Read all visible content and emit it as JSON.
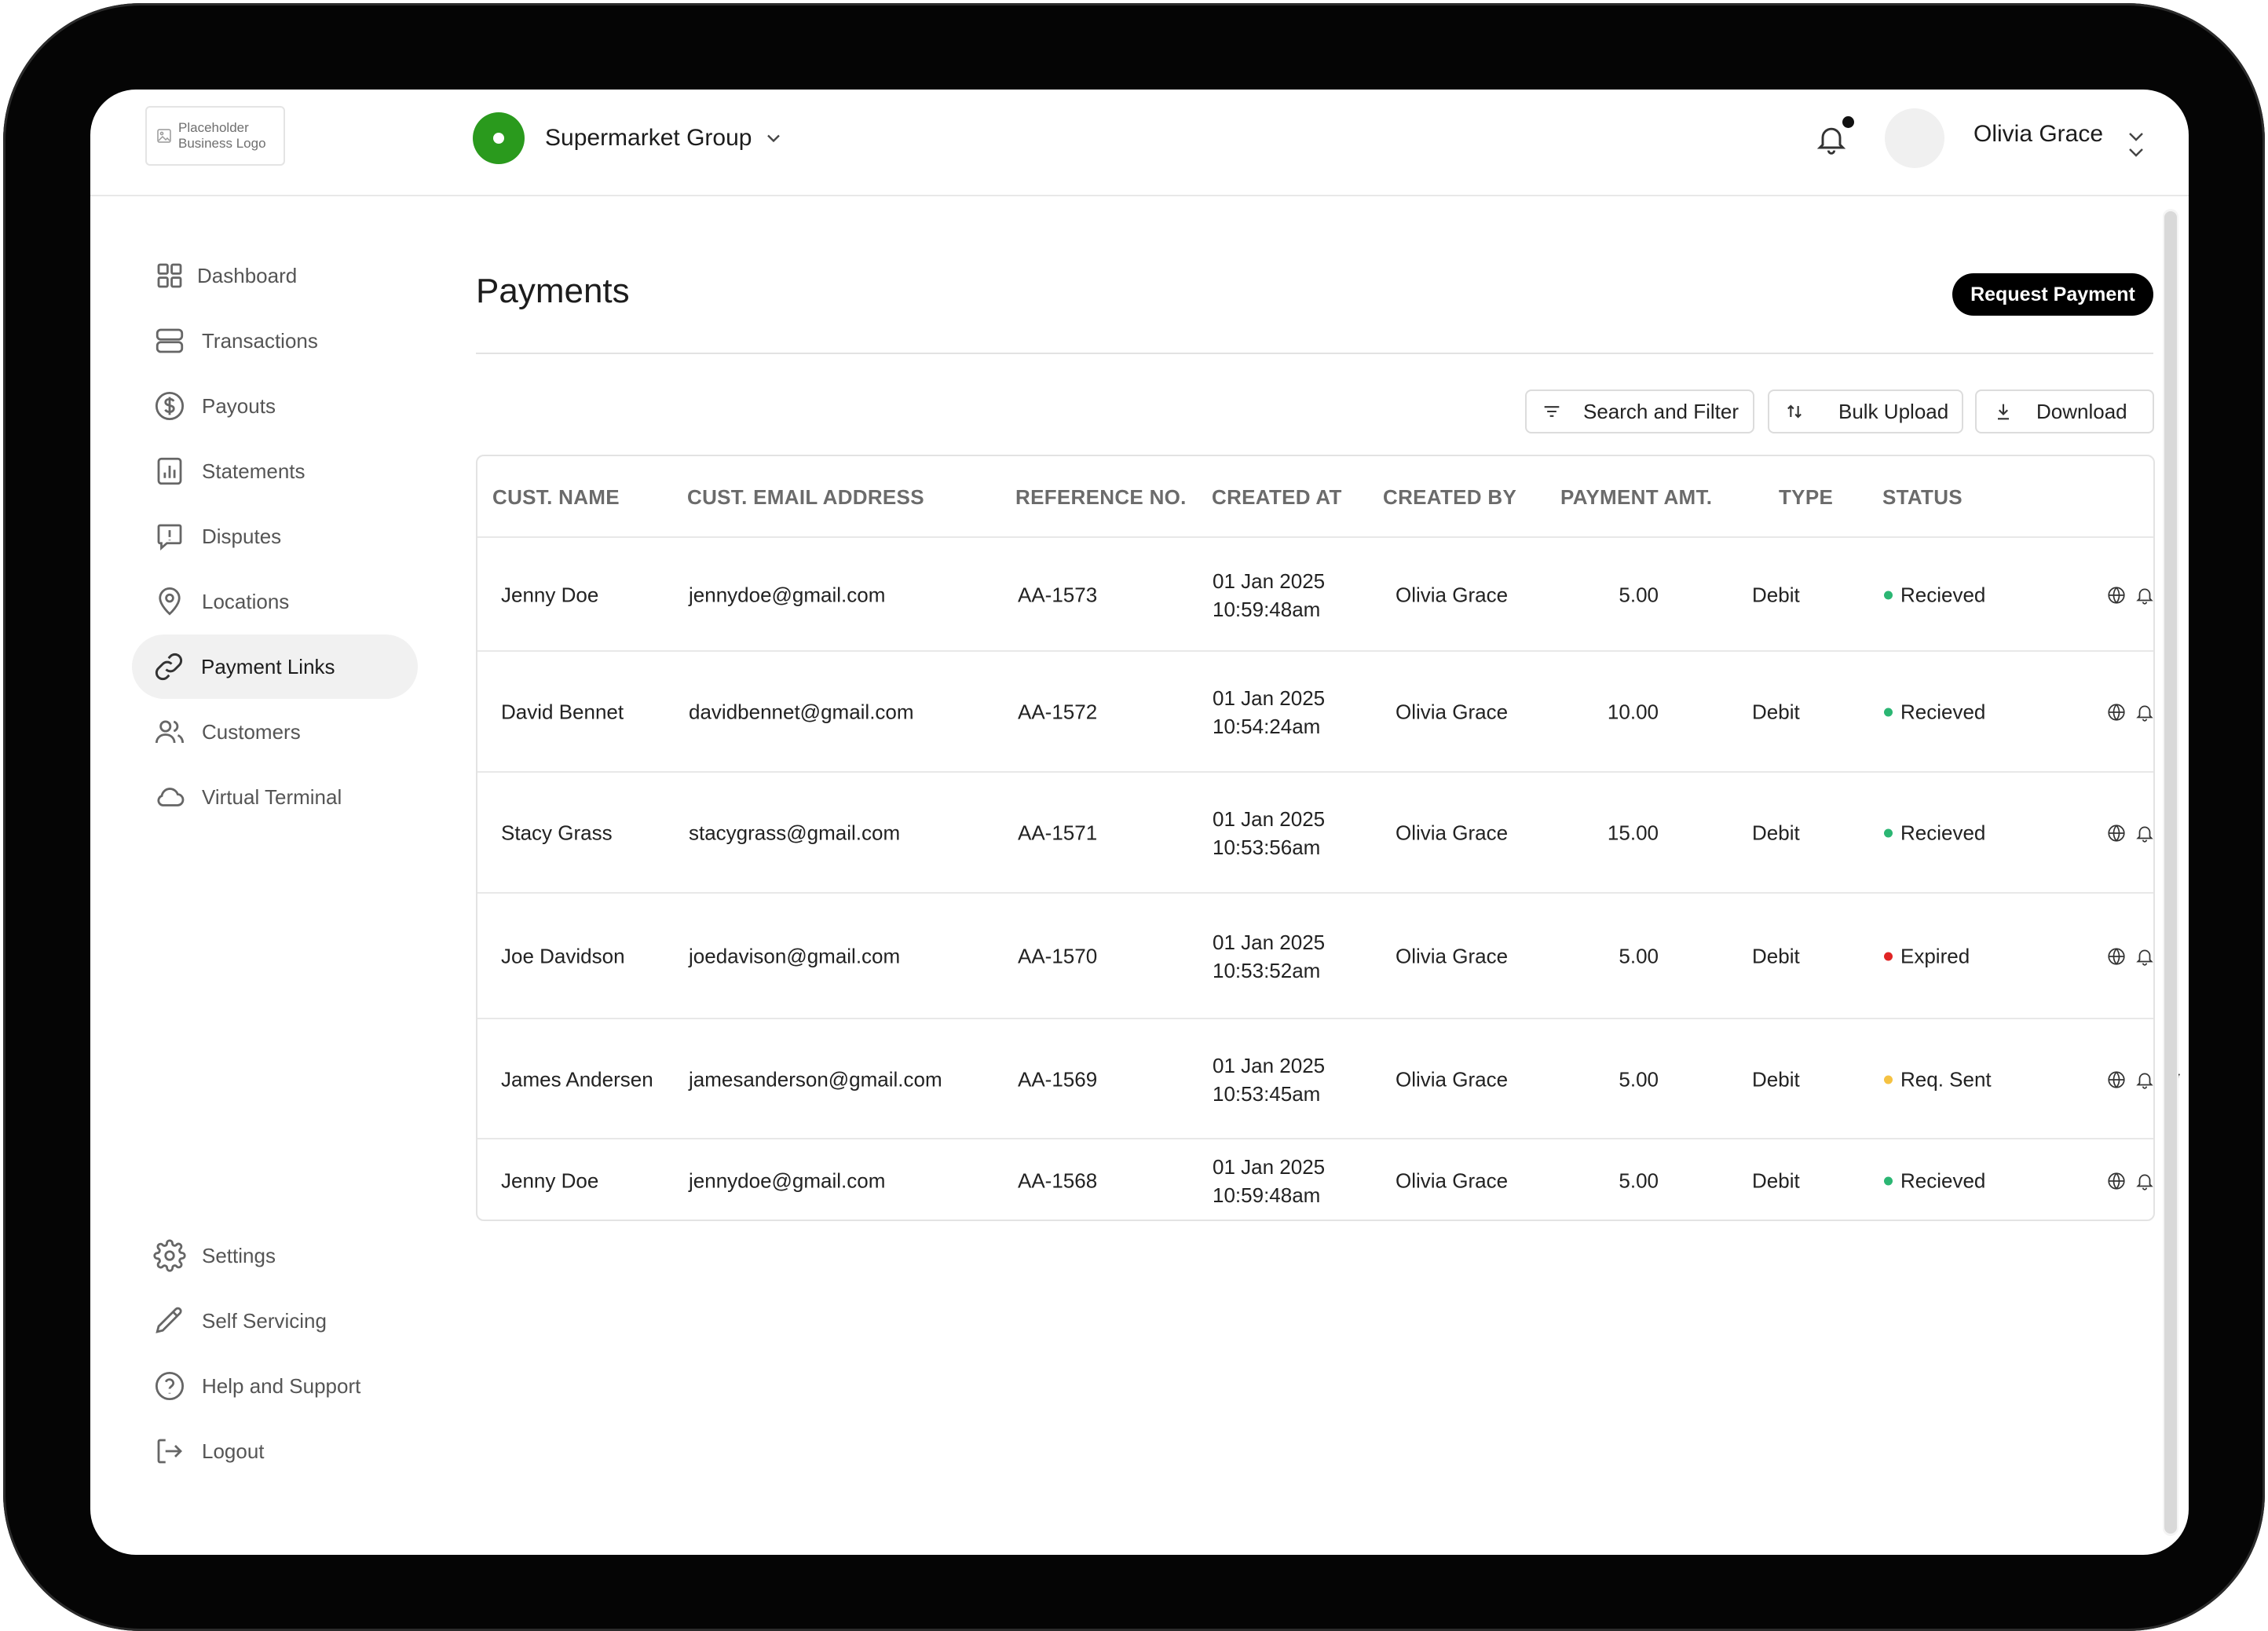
{
  "logo": {
    "line1": "Placeholder",
    "line2": "Business Logo"
  },
  "business": {
    "name": "Supermarket Group",
    "accent_color": "#2a9a1d"
  },
  "user": {
    "name": "Olivia Grace"
  },
  "sidebar": {
    "items": [
      {
        "label": "Dashboard",
        "icon": "grid-icon"
      },
      {
        "label": "Transactions",
        "icon": "layers-icon"
      },
      {
        "label": "Payouts",
        "icon": "dollar-circle-icon"
      },
      {
        "label": "Statements",
        "icon": "bar-chart-icon"
      },
      {
        "label": "Disputes",
        "icon": "alert-message-icon"
      },
      {
        "label": "Locations",
        "icon": "map-pin-icon"
      },
      {
        "label": "Payment Links",
        "icon": "link-icon",
        "active": true
      },
      {
        "label": "Customers",
        "icon": "users-icon"
      },
      {
        "label": "Virtual Terminal",
        "icon": "cloud-icon"
      }
    ],
    "bottom_items": [
      {
        "label": "Settings",
        "icon": "gear-icon"
      },
      {
        "label": "Self Servicing",
        "icon": "pencil-icon"
      },
      {
        "label": "Help and Support",
        "icon": "help-circle-icon"
      },
      {
        "label": "Logout",
        "icon": "logout-icon"
      }
    ]
  },
  "main": {
    "title": "Payments",
    "request_button": "Request Payment",
    "toolbar": {
      "search": "Search and Filter",
      "bulk": "Bulk Upload",
      "download": "Download"
    }
  },
  "table": {
    "headers": [
      "CUST. NAME",
      "CUST. EMAIL ADDRESS",
      "REFERENCE NO.",
      "CREATED AT",
      "CREATED BY",
      "PAYMENT AMT.",
      "TYPE",
      "STATUS"
    ],
    "rows": [
      {
        "name": "Jenny Doe",
        "email": "jennydoe@gmail.com",
        "ref": "AA-1573",
        "date": "01 Jan 2025",
        "time": "10:59:48am",
        "by": "Olivia Grace",
        "amount": "5.00",
        "type": "Debit",
        "status": "Recieved",
        "status_color": "#2bb673",
        "actions": [
          "globe-icon",
          "bell-icon"
        ]
      },
      {
        "name": "David Bennet",
        "email": "davidbennet@gmail.com",
        "ref": "AA-1572",
        "date": "01 Jan 2025",
        "time": "10:54:24am",
        "by": "Olivia Grace",
        "amount": "10.00",
        "type": "Debit",
        "status": "Recieved",
        "status_color": "#2bb673",
        "actions": [
          "globe-icon",
          "bell-icon"
        ]
      },
      {
        "name": "Stacy Grass",
        "email": "stacygrass@gmail.com",
        "ref": "AA-1571",
        "date": "01 Jan 2025",
        "time": "10:53:56am",
        "by": "Olivia Grace",
        "amount": "15.00",
        "type": "Debit",
        "status": "Recieved",
        "status_color": "#2bb673",
        "actions": [
          "globe-icon",
          "bell-icon"
        ]
      },
      {
        "name": "Joe Davidson",
        "email": "joedavison@gmail.com",
        "ref": "AA-1570",
        "date": "01 Jan 2025",
        "time": "10:53:52am",
        "by": "Olivia Grace",
        "amount": "5.00",
        "type": "Debit",
        "status": "Expired",
        "status_color": "#e02424",
        "actions": [
          "globe-icon",
          "bell-icon"
        ]
      },
      {
        "name": "James Andersen",
        "email": "jamesanderson@gmail.com",
        "ref": "AA-1569",
        "date": "01 Jan 2025",
        "time": "10:53:45am",
        "by": "Olivia Grace",
        "amount": "5.00",
        "type": "Debit",
        "status": "Req. Sent",
        "status_color": "#f5c242",
        "actions": [
          "globe-icon",
          "bell-icon",
          "trash-icon",
          "info-icon"
        ]
      },
      {
        "name": "Jenny Doe",
        "email": "jennydoe@gmail.com",
        "ref": "AA-1568",
        "date": "01 Jan 2025",
        "time": "10:59:48am",
        "by": "Olivia Grace",
        "amount": "5.00",
        "type": "Debit",
        "status": "Recieved",
        "status_color": "#2bb673",
        "actions": [
          "globe-icon",
          "bell-icon"
        ]
      }
    ]
  }
}
